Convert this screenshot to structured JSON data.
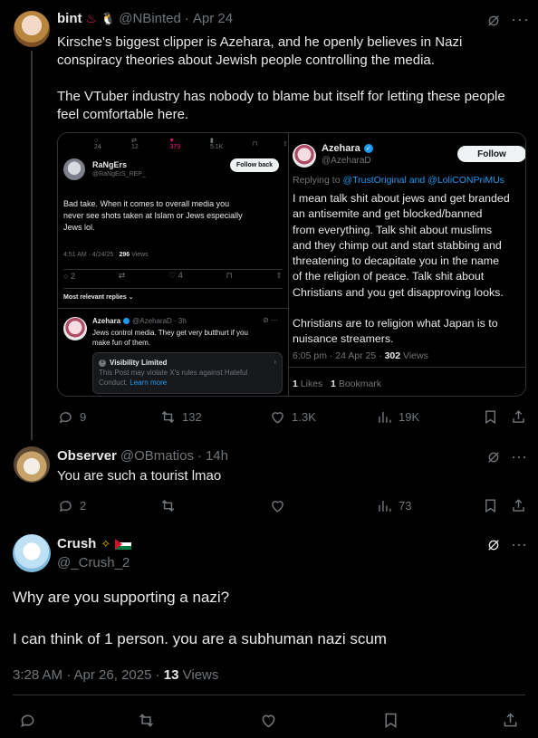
{
  "post1": {
    "name": "bint",
    "handle": "@NBinted",
    "dot": "·",
    "date": "Apr 24",
    "line1": "Kirsche's biggest clipper is Azehara, and he openly believes in Nazi",
    "line2": "conspiracy theories about Jewish people controlling the media.",
    "line3": "The VTuber industry has nobody to blame but itself for letting these people",
    "line4": "feel comfortable here.",
    "replies": "9",
    "reposts": "132",
    "likes": "1.3K",
    "views": "19K"
  },
  "shot_left": {
    "top_replies": "24",
    "top_reposts": "12",
    "top_likes": "379",
    "top_views": "5.1K",
    "name": "RaNgErs",
    "handle": "@RaNgErS_REP_",
    "follow_back": "Follow back",
    "text1": "Bad take. When it comes to overall media you",
    "text2": "never see shots taken at Islam or Jews especially",
    "text3": "Jews lol.",
    "time": "4:51 AM · 4/24/25 ·",
    "views_count": "296",
    "views_label": "Views",
    "replies": "2",
    "likes": "4",
    "most_relevant": "Most relevant replies",
    "reply_name": "Azehara",
    "reply_handle": "@AzeharaD · 3h",
    "reply_text1": "Jews control media.  They get very butthurt if you",
    "reply_text2": "make fun of them.",
    "vis_title": "Visibility Limited",
    "vis_text1": "This Post may violate X's rules against Hateful",
    "vis_text2": "Conduct.",
    "learn_more": "Learn more"
  },
  "shot_right": {
    "name": "Azehara",
    "handle": "@AzeharaD",
    "follow": "Follow",
    "replying": "Replying to",
    "reply_targets": "@TrustOriginal and @LoliCONPriMUs",
    "l1": "I mean talk shit about jews and get branded",
    "l2": "an antisemite and get blocked/banned",
    "l3": "from everything.   Talk shit about muslims",
    "l4": "and they chimp out and start stabbing and",
    "l5": "threatening to decapitate you in the name",
    "l6": "of the religion of peace.  Talk shit about",
    "l7": "Christians and you get disapproving looks.",
    "l8": "Christians are to religion what Japan is to",
    "l9": "nuisance streamers.",
    "time": "6:05 pm · 24 Apr 25 ·",
    "views_count": "302",
    "views_label": "Views",
    "likes_count": "1",
    "likes_label": "Likes",
    "bookmark_count": "1",
    "bookmark_label": "Bookmark"
  },
  "post2": {
    "name": "Observer",
    "handle": "@OBmatios",
    "dot": "·",
    "date": "14h",
    "text": "You are such a tourist lmao",
    "replies": "2",
    "views": "73"
  },
  "post3": {
    "name": "Crush",
    "handle": "@_Crush_2",
    "line1": "Why are you supporting a nazi?",
    "line2": "I can think of 1 person. you are a subhuman nazi scum",
    "time": "3:28 AM · Apr 26, 2025 ·",
    "views_count": "13",
    "views_label": "Views"
  },
  "colors": {
    "accent": "#1d9bf0",
    "like_pink": "#f91880",
    "muted": "#71767b",
    "border": "#2f3336",
    "palestine_red": "#ce1126",
    "palestine_green": "#007a3d"
  }
}
